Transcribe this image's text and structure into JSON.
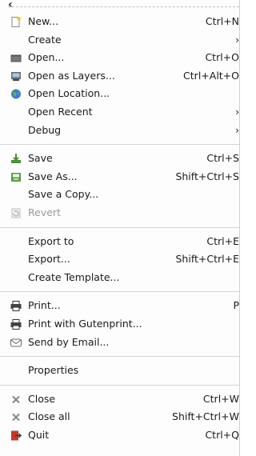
{
  "menu": {
    "tearoff": {
      "back_glyph": "‹"
    },
    "groups": [
      [
        {
          "label": "New...",
          "accel": "Ctrl+N",
          "icon": "new-file-icon"
        },
        {
          "label": "Create",
          "accel": "›",
          "submenu": true
        },
        {
          "label": "Open...",
          "accel": "Ctrl+O",
          "icon": "open-folder-icon"
        },
        {
          "label": "Open as Layers...",
          "accel": "Ctrl+Alt+O",
          "icon": "open-layers-icon"
        },
        {
          "label": "Open Location...",
          "accel": "",
          "icon": "globe-icon"
        },
        {
          "label": "Open Recent",
          "accel": "›",
          "submenu": true
        },
        {
          "label": "Debug",
          "accel": "›",
          "submenu": true
        }
      ],
      [
        {
          "label": "Save",
          "accel": "Ctrl+S",
          "icon": "save-icon"
        },
        {
          "label": "Save As...",
          "accel": "Shift+Ctrl+S",
          "icon": "save-as-icon"
        },
        {
          "label": "Save a Copy...",
          "accel": ""
        },
        {
          "label": "Revert",
          "accel": "",
          "icon": "revert-icon",
          "disabled": true
        }
      ],
      [
        {
          "label": "Export to",
          "accel": "Ctrl+E"
        },
        {
          "label": "Export...",
          "accel": "Shift+Ctrl+E"
        },
        {
          "label": "Create Template...",
          "accel": ""
        }
      ],
      [
        {
          "label": "Print...",
          "accel": "P",
          "icon": "printer-icon"
        },
        {
          "label": "Print with Gutenprint...",
          "accel": "",
          "icon": "printer-icon"
        },
        {
          "label": "Send by Email...",
          "accel": "",
          "icon": "email-icon"
        }
      ],
      [
        {
          "label": "Properties",
          "accel": ""
        }
      ],
      [
        {
          "label": "Close",
          "accel": "Ctrl+W",
          "icon": "close-icon"
        },
        {
          "label": "Close all",
          "accel": "Shift+Ctrl+W",
          "icon": "close-icon"
        },
        {
          "label": "Quit",
          "accel": "Ctrl+Q",
          "icon": "quit-icon"
        }
      ]
    ]
  }
}
